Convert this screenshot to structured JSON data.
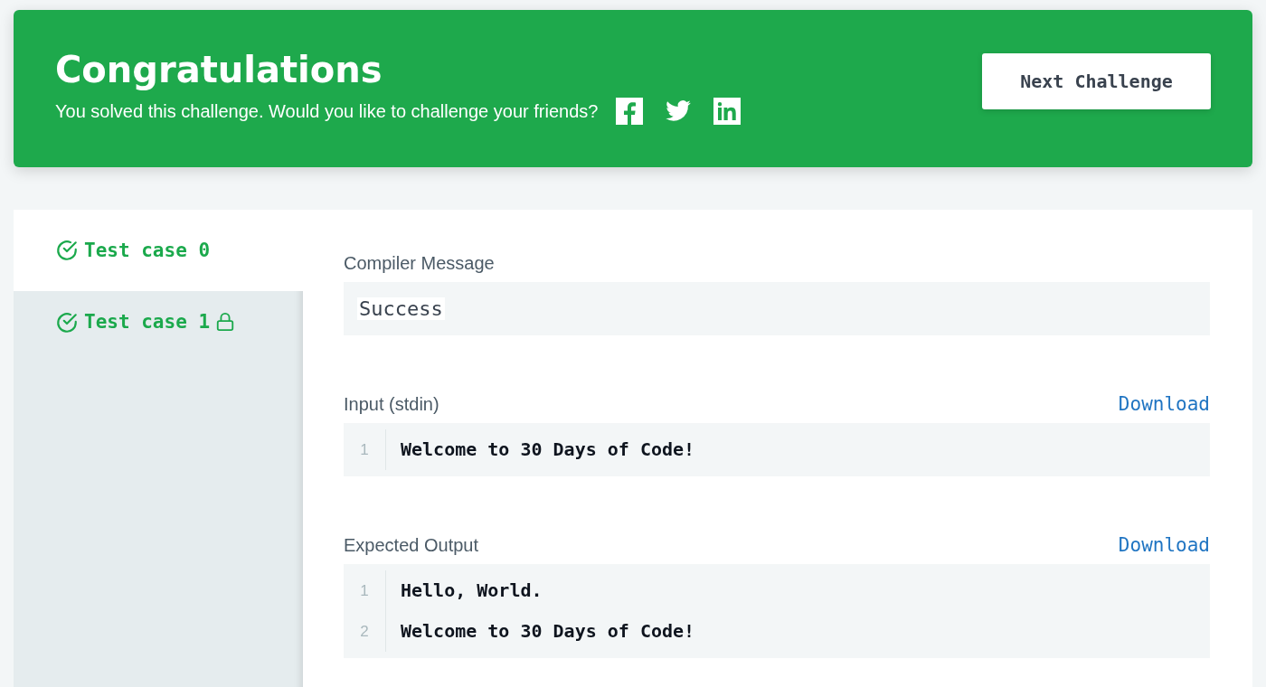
{
  "banner": {
    "title": "Congratulations",
    "message": "You solved this challenge. Would you like to challenge your friends?",
    "share": [
      {
        "kind": "facebook"
      },
      {
        "kind": "twitter"
      },
      {
        "kind": "linkedin"
      }
    ],
    "button": "Next Challenge"
  },
  "test_cases": [
    {
      "label": "Test case 0",
      "selected": true,
      "passed": true,
      "locked": false
    },
    {
      "label": "Test case 1",
      "selected": false,
      "passed": true,
      "locked": true
    }
  ],
  "sections": [
    {
      "kind": "message",
      "label": "Compiler Message",
      "value": "Success"
    },
    {
      "kind": "code",
      "label": "Input (stdin)",
      "link": "Download",
      "lines": [
        {
          "number": "1",
          "text": "Welcome to 30 Days of Code!"
        }
      ]
    },
    {
      "kind": "code",
      "label": "Expected Output",
      "link": "Download",
      "lines": [
        {
          "number": "1",
          "text": "Hello, World."
        },
        {
          "number": "2",
          "text": "Welcome to 30 Days of Code!"
        }
      ]
    }
  ]
}
